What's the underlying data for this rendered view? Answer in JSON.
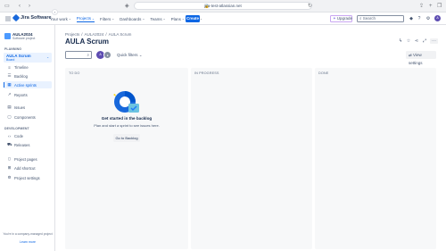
{
  "browser": {
    "url": "jira-test-atlassian.net",
    "icons": [
      "sidebar-toggle-icon",
      "back-icon",
      "forward-icon",
      "shield-icon",
      "reload-icon",
      "share-icon",
      "new-tab-icon",
      "tabs-icon"
    ]
  },
  "topnav": {
    "app_name": "Jira Software",
    "items": [
      {
        "label": "Your work",
        "active": false
      },
      {
        "label": "Projects",
        "active": true
      },
      {
        "label": "Filters",
        "active": false
      },
      {
        "label": "Dashboards",
        "active": false
      },
      {
        "label": "Teams",
        "active": false
      },
      {
        "label": "Plans",
        "active": false
      },
      {
        "label": "Apps",
        "active": false
      }
    ],
    "create_label": "Create",
    "upgrade_label": "Upgrade",
    "search_placeholder": "Search",
    "avatar_initials": "A"
  },
  "sidebar": {
    "project_name": "AULA2024",
    "project_type": "Software project",
    "planning_header": "PLANNING",
    "board_name": "AULA Scrum",
    "board_type": "Board",
    "planning_items": [
      {
        "label": "Timeline",
        "icon": "timeline-icon",
        "active": false
      },
      {
        "label": "Backlog",
        "icon": "backlog-icon",
        "active": false
      },
      {
        "label": "Active sprints",
        "icon": "board-icon",
        "active": true
      },
      {
        "label": "Reports",
        "icon": "reports-icon",
        "active": false
      }
    ],
    "other_items": [
      {
        "label": "Issues",
        "icon": "issues-icon"
      },
      {
        "label": "Components",
        "icon": "components-icon"
      }
    ],
    "development_header": "DEVELOPMENT",
    "dev_items": [
      {
        "label": "Code",
        "icon": "code-icon"
      },
      {
        "label": "Releases",
        "icon": "releases-icon"
      }
    ],
    "bottom_items": [
      {
        "label": "Project pages",
        "icon": "pages-icon"
      },
      {
        "label": "Add shortcut",
        "icon": "shortcut-icon"
      },
      {
        "label": "Project settings",
        "icon": "settings-icon"
      }
    ],
    "footer_text": "You're in a company-managed project",
    "learn_more": "Learn more"
  },
  "main": {
    "breadcrumb": [
      "Projects",
      "AULA2024",
      "AULA Scrum"
    ],
    "title": "AULA Scrum",
    "quick_filters": "Quick filters",
    "view_settings": "View settings",
    "avatar1": "A",
    "columns": [
      "TO DO",
      "IN PROGRESS",
      "DONE"
    ],
    "empty_title": "Get started in the backlog",
    "empty_sub": "Plan and start a sprint to see issues here.",
    "go_backlog": "Go to Backlog"
  },
  "colors": {
    "brand": "#0c66e4",
    "selected_bg": "#e9f2ff",
    "column_bg": "#f7f8f9"
  }
}
